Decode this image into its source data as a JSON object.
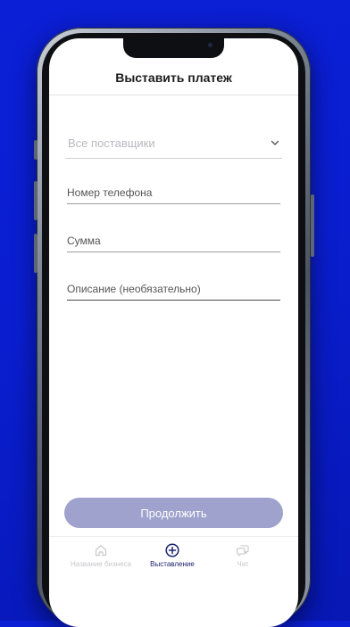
{
  "header": {
    "title": "Выставить платеж"
  },
  "form": {
    "provider_select": {
      "value": "Все поставщики",
      "icon": "chevron-down-icon"
    },
    "phone_field": {
      "placeholder": "Номер телефона",
      "value": ""
    },
    "amount_field": {
      "placeholder": "Сумма",
      "value": ""
    },
    "description_field": {
      "placeholder": "Описание (необязательно)",
      "value": ""
    },
    "continue_label": "Продолжить"
  },
  "tabbar": {
    "items": [
      {
        "label": "Название бизнеса",
        "icon": "home-icon",
        "active": false
      },
      {
        "label": "Выставление",
        "icon": "plus-circle-icon",
        "active": true
      },
      {
        "label": "Чат",
        "icon": "chat-icon",
        "active": false
      }
    ]
  },
  "colors": {
    "background": "#0a1ed0",
    "button": "#9ea2cc",
    "active_tab": "#1b2370",
    "inactive_tab": "#c7c7cc"
  }
}
